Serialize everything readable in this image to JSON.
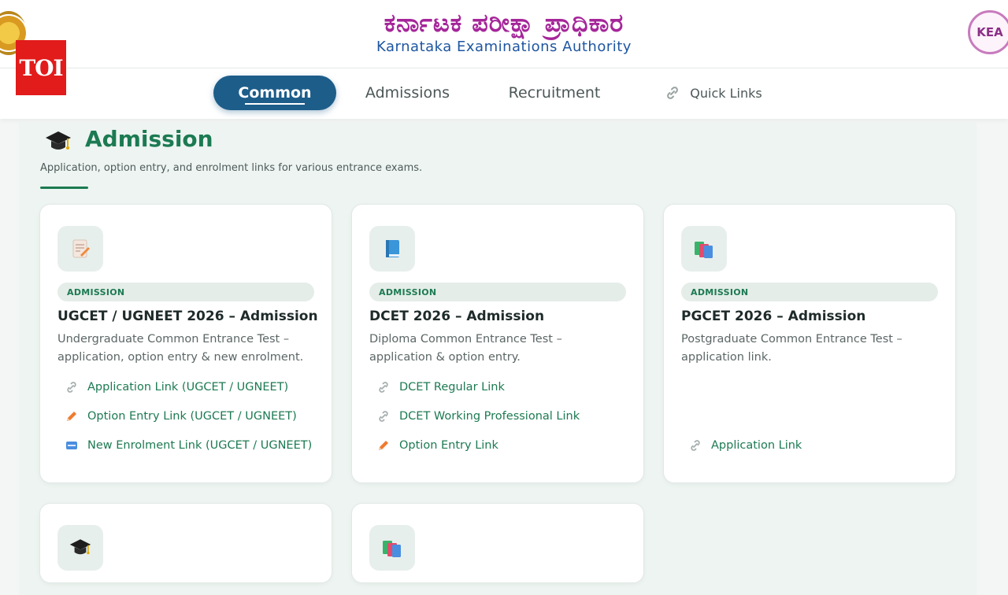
{
  "header": {
    "title_kannada": "ಕರ್ನಾಟಕ ಪರೀಕ್ಷಾ ಪ್ರಾಧಿಕಾರ",
    "title_english": "Karnataka Examinations Authority",
    "overlay_badge": "TOI",
    "right_logo_text": "KEA"
  },
  "nav": {
    "tabs": [
      {
        "label": "Common",
        "active": true
      },
      {
        "label": "Admissions",
        "active": false
      },
      {
        "label": "Recruitment",
        "active": false
      },
      {
        "label": "Quick Links",
        "active": false,
        "icon": "link-icon"
      }
    ]
  },
  "section": {
    "icon": "graduation-cap-icon",
    "title": "Admission",
    "subtitle": "Application, option entry, and enrolment links for various entrance exams."
  },
  "cards": [
    {
      "icon": "memo-icon",
      "badge": "ADMISSION",
      "title": "UGCET / UGNEET 2026 – Admission",
      "desc": "Undergraduate Common Entrance Test – application, option entry & new enrolment.",
      "links": [
        {
          "label": "Application Link (UGCET / UGNEET)",
          "icon": "link-icon"
        },
        {
          "label": "Option Entry Link (UGCET / UGNEET)",
          "icon": "pencil-icon"
        },
        {
          "label": "New Enrolment Link (UGCET / UGNEET)",
          "icon": "new-icon"
        }
      ]
    },
    {
      "icon": "blue-book-icon",
      "badge": "ADMISSION",
      "title": "DCET 2026 – Admission",
      "desc": "Diploma Common Entrance Test – application & option entry.",
      "links": [
        {
          "label": "DCET Regular Link",
          "icon": "link-icon"
        },
        {
          "label": "DCET Working Professional Link",
          "icon": "link-icon"
        },
        {
          "label": "Option Entry Link",
          "icon": "pencil-icon"
        }
      ]
    },
    {
      "icon": "books-icon",
      "badge": "ADMISSION",
      "title": "PGCET 2026 – Admission",
      "desc": "Postgraduate Common Entrance Test – application link.",
      "links": [
        {
          "label": "Application Link",
          "icon": "link-icon"
        }
      ]
    },
    {
      "icon": "graduation-cap-icon"
    },
    {
      "icon": "books-icon"
    }
  ],
  "colors": {
    "brand_green": "#1c7a52",
    "nav_active": "#1d5d8a",
    "kannada_title": "#a5269a",
    "english_title": "#1e56a0"
  }
}
